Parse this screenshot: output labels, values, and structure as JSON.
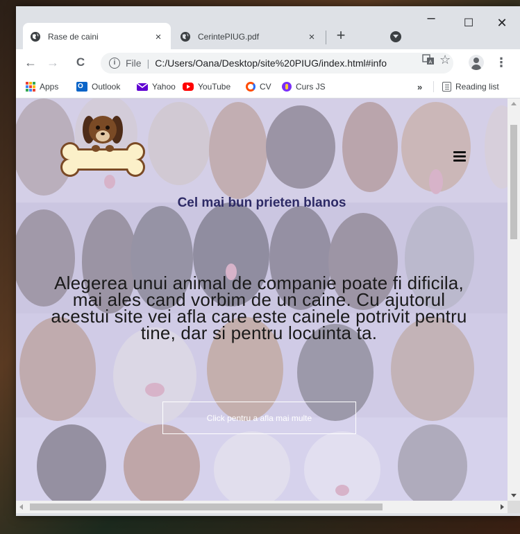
{
  "browser": {
    "tabs": [
      {
        "title": "Rase de caini",
        "active": true
      },
      {
        "title": "CerintePIUG.pdf",
        "active": false
      }
    ],
    "tab_close_glyph": "×",
    "new_tab_glyph": "+",
    "window_controls": {
      "minimize": "–",
      "maximize": "☐",
      "close": "✕"
    },
    "address": {
      "scheme_label": "File",
      "url": "C:/Users/Oana/Desktop/site%20PIUG/index.html#info"
    },
    "nav_glyphs": {
      "back": "←",
      "forward": "→",
      "reload": "C",
      "menu": "⋮",
      "star": "☆"
    },
    "bookmarks": [
      {
        "label": "Apps",
        "icon": "apps-grid-icon"
      },
      {
        "label": "Outlook",
        "icon": "outlook-icon",
        "color": "#0a64c8"
      },
      {
        "label": "Yahoo",
        "icon": "yahoo-mail-icon",
        "color": "#6001d2"
      },
      {
        "label": "YouTube",
        "icon": "youtube-icon",
        "color": "#ff0000"
      },
      {
        "label": "CV",
        "icon": "cv-icon",
        "color": "#ff4b00"
      },
      {
        "label": "Curs JS",
        "icon": "curs-js-icon",
        "color": "#7b2ff7"
      }
    ],
    "bookmarks_overflow": "»",
    "reading_list": "Reading list"
  },
  "page": {
    "tagline": "Cel mai bun prieten blanos",
    "hero_text": "Alegerea unui animal de companie poate fi dificila, mai ales cand vorbim de un caine. Cu ajutorul acestui site vei afla care este cainele potrivit pentru tine, dar si pentru locuinta ta.",
    "cta_label": "Click pentru a afla mai multe",
    "colors": {
      "tagline": "#2d2a66",
      "overlay": "#d6d4f0"
    }
  }
}
